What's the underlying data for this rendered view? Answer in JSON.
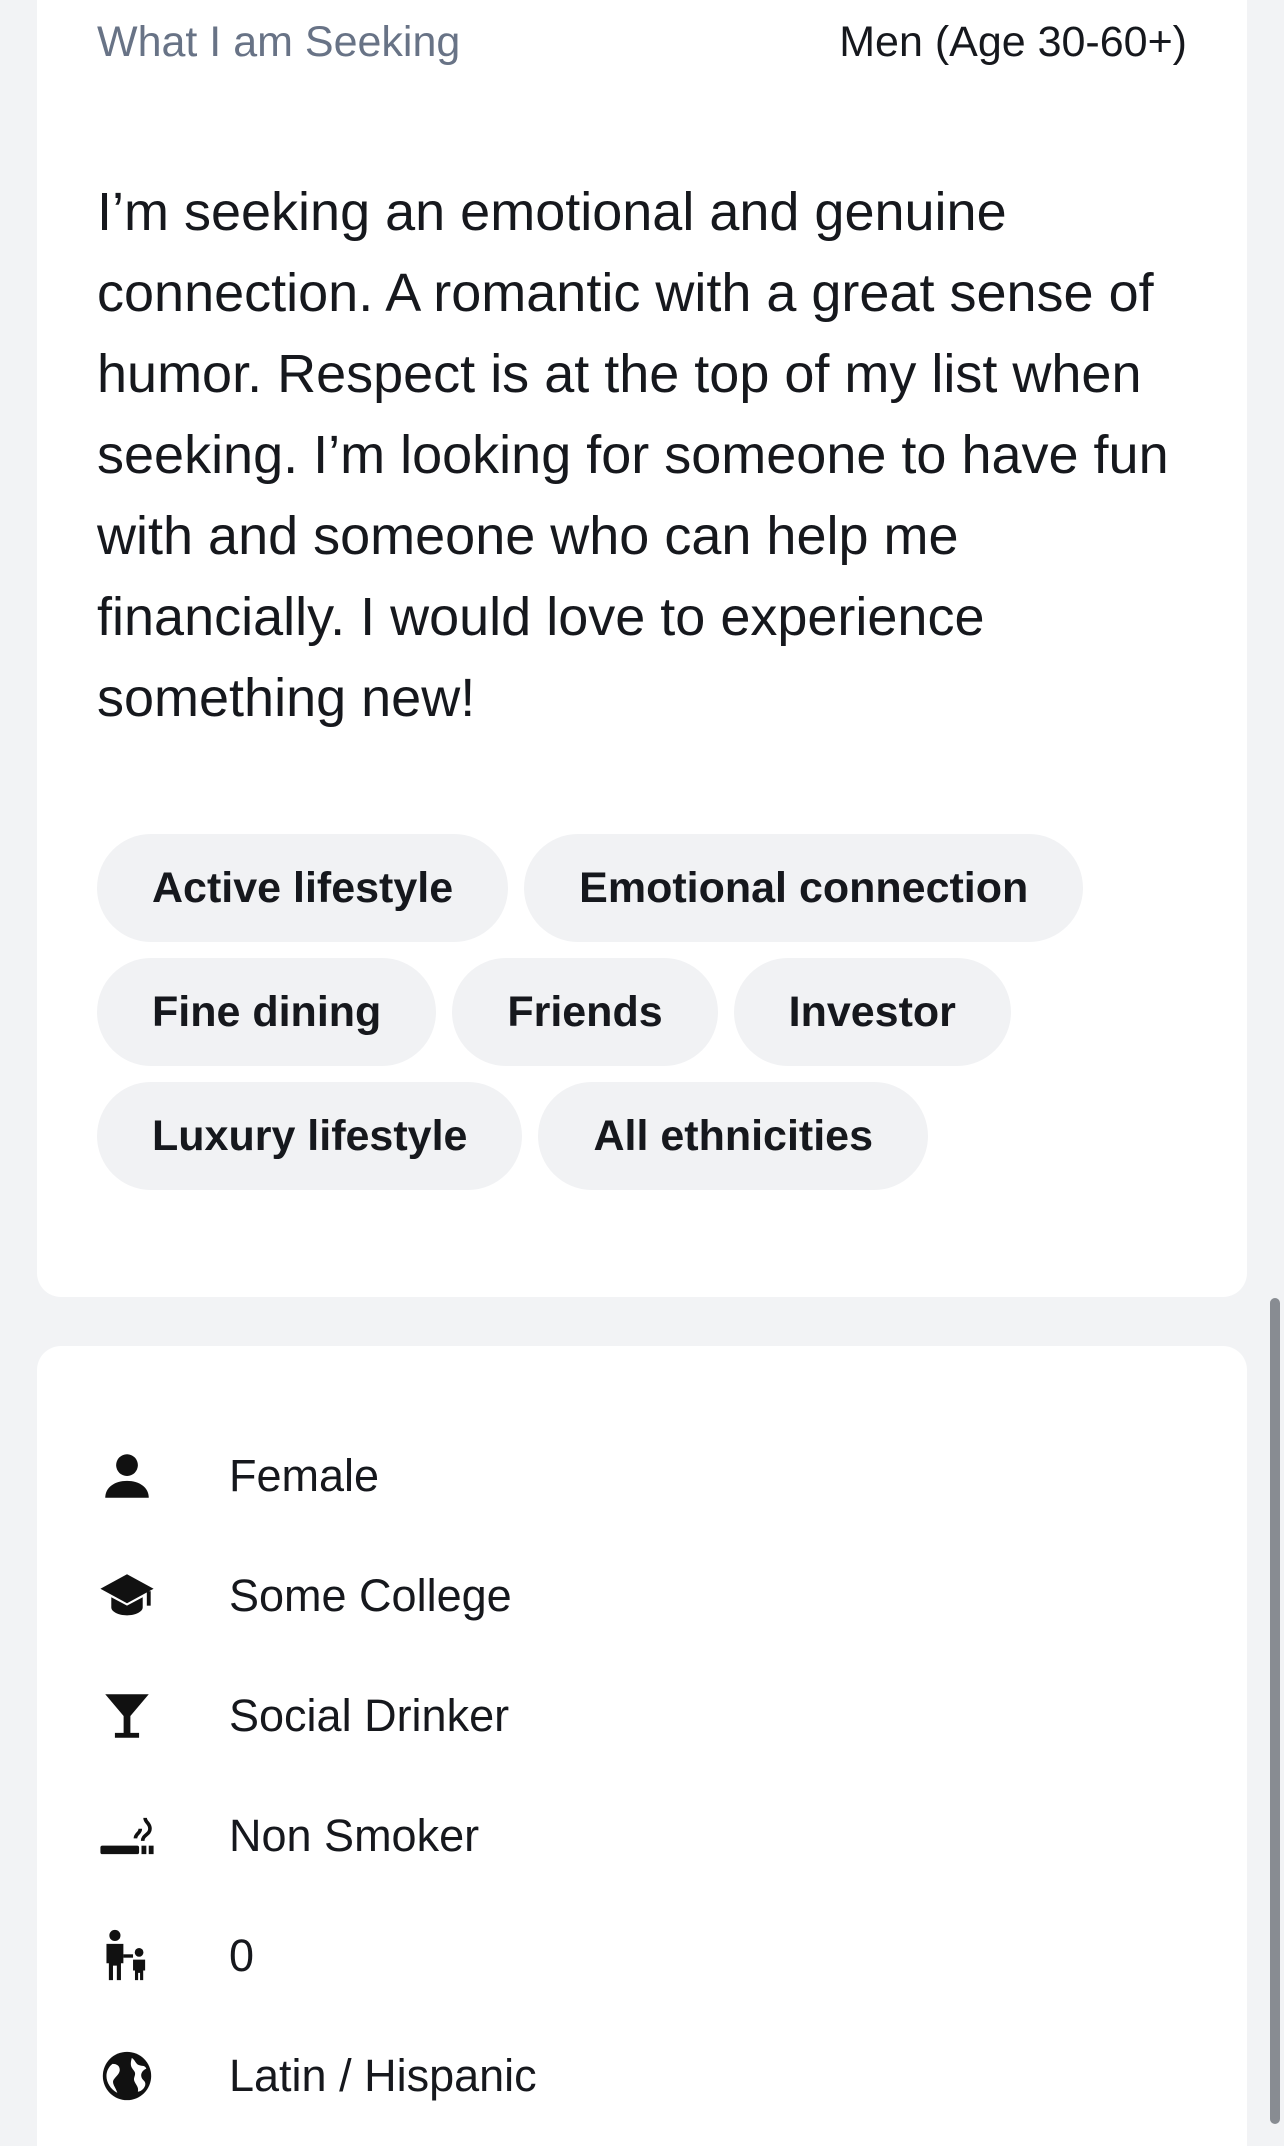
{
  "seeking": {
    "label": "What I am Seeking",
    "target": "Men (Age 30-60+)",
    "description": "I’m seeking an emotional and genuine connection. A romantic with a great sense of humor. Respect is at the top of my list when seeking. I’m looking for someone to have fun with and someone who can help me financially. I would love to experience something new!",
    "tags": [
      "Active lifestyle",
      "Emotional connection",
      "Fine dining",
      "Friends",
      "Investor",
      "Luxury lifestyle",
      "All ethnicities"
    ]
  },
  "details": [
    {
      "icon": "person-icon",
      "value": "Female"
    },
    {
      "icon": "graduation-cap-icon",
      "value": "Some College"
    },
    {
      "icon": "cocktail-glass-icon",
      "value": "Social Drinker"
    },
    {
      "icon": "smoking-icon",
      "value": "Non Smoker"
    },
    {
      "icon": "parent-child-icon",
      "value": "0"
    },
    {
      "icon": "globe-icon",
      "value": "Latin / Hispanic"
    }
  ],
  "colors": {
    "background": "#f2f3f5",
    "card": "#ffffff",
    "text": "#16181d",
    "muted": "#687386",
    "tag": "#f1f2f4"
  }
}
